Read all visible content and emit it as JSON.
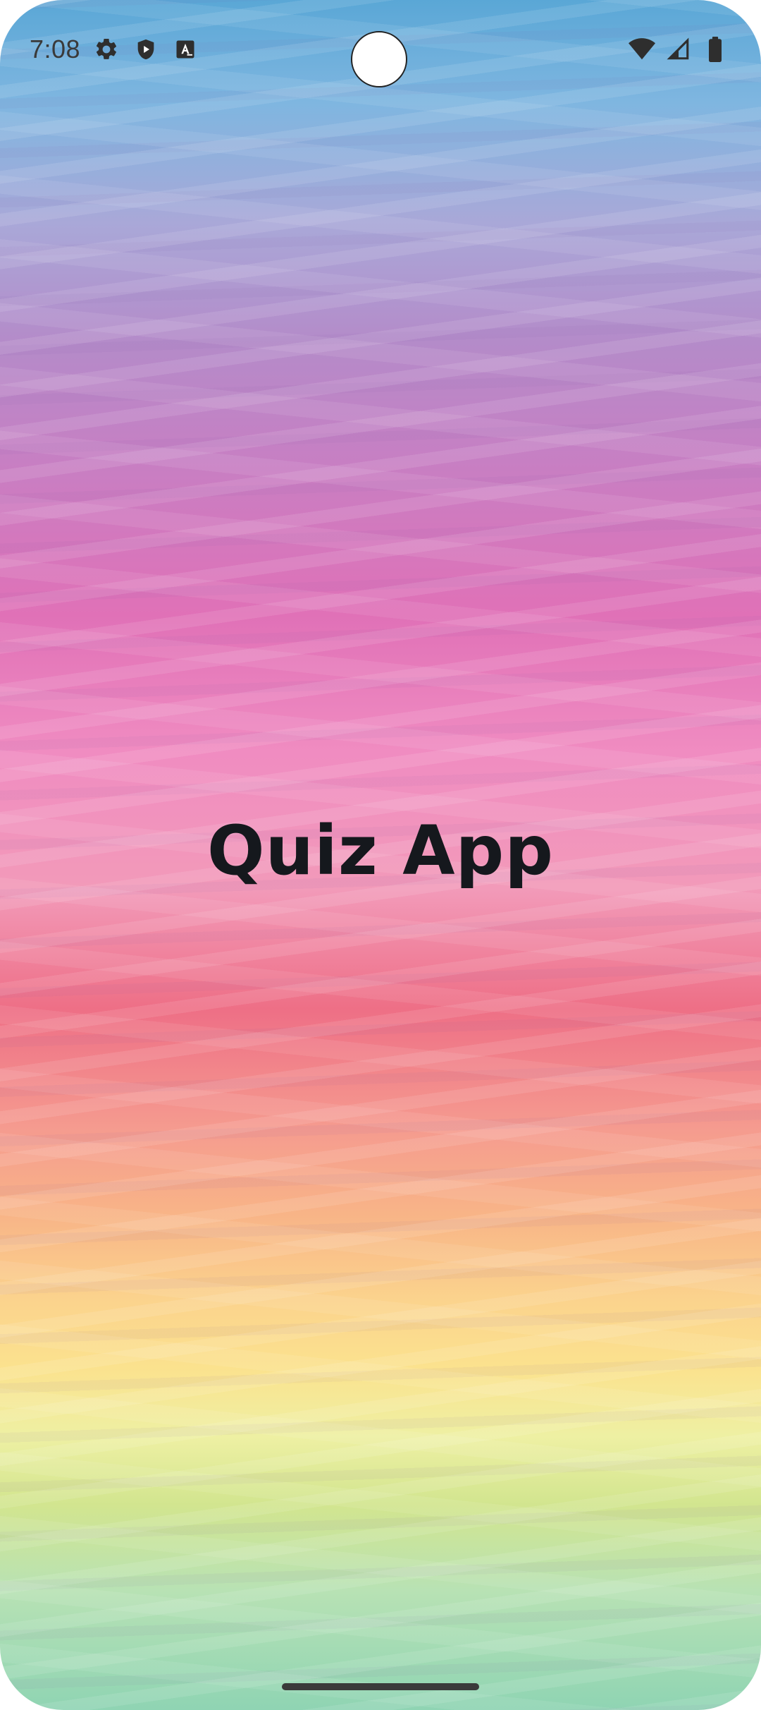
{
  "status_bar": {
    "time": "7:08",
    "left_icons": [
      "gear-icon",
      "shield-play-icon",
      "text-a-icon"
    ],
    "right_icons": [
      "wifi-icon",
      "signal-icon",
      "battery-icon"
    ]
  },
  "main": {
    "title": "Quiz App"
  },
  "colors": {
    "title_text": "#15181d",
    "status_text": "#3a3a3a"
  }
}
